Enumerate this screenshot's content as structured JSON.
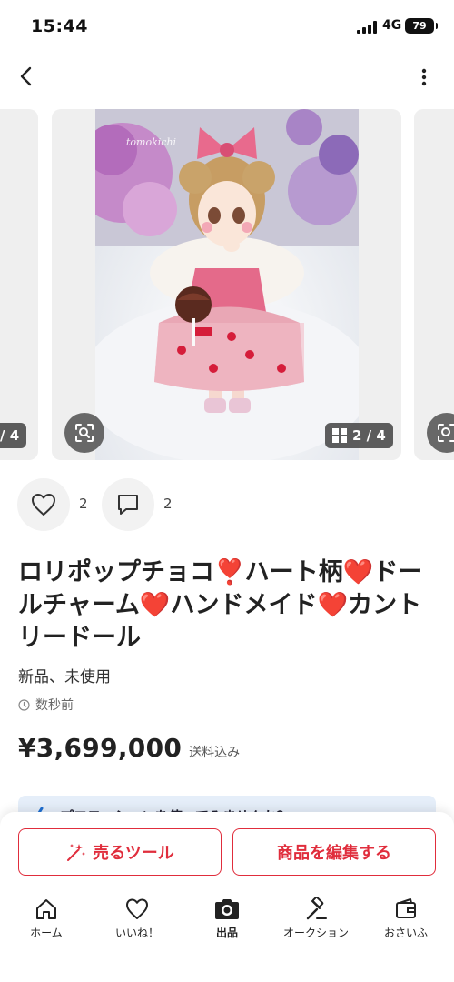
{
  "status_bar": {
    "time": "15:44",
    "network": "4G",
    "battery": "79"
  },
  "carousel": {
    "prev_indicator": "/ 4",
    "current_indicator": "2 / 4",
    "watermark": "tomokichi"
  },
  "reactions": {
    "likes": "2",
    "comments": "2"
  },
  "item": {
    "title_parts": [
      "ロリポップチョコ",
      "❣️",
      "ハート柄",
      "❤️",
      "ドールチャーム",
      "❤️",
      "ハンドメイド",
      "❤️",
      "カントリードール"
    ],
    "condition": "新品、未使用",
    "posted": "数秒前",
    "price": "¥3,699,000",
    "shipping": "送料込み"
  },
  "promo": {
    "text": "プロモーションを使ってみませんか？"
  },
  "actions": {
    "sell_tools": "売るツール",
    "edit_item": "商品を編集する"
  },
  "tabs": [
    {
      "label": "ホーム",
      "icon": "home-icon"
    },
    {
      "label": "いいね！",
      "icon": "heart-icon"
    },
    {
      "label": "出品",
      "icon": "camera-icon"
    },
    {
      "label": "オークション",
      "icon": "gavel-icon"
    },
    {
      "label": "おさいふ",
      "icon": "wallet-icon"
    }
  ],
  "colors": {
    "accent": "#e02d3c",
    "heart": "#e8132b"
  }
}
